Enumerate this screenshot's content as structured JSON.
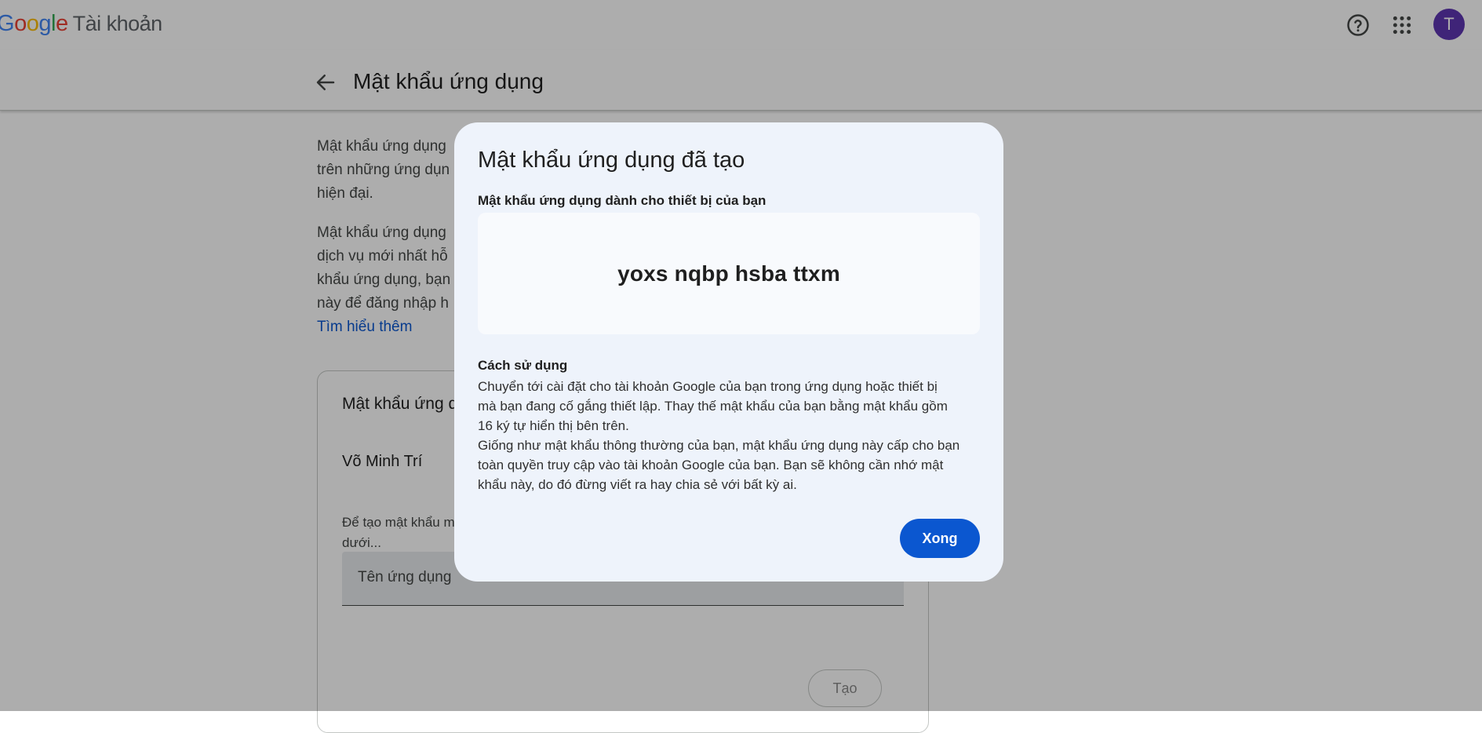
{
  "header": {
    "logo_letters": [
      "G",
      "o",
      "o",
      "g",
      "l",
      "e"
    ],
    "product_name": "Tài khoản",
    "avatar_initial": "T",
    "icons": [
      "help-icon",
      "apps-grid-icon"
    ]
  },
  "subheader": {
    "title": "Mật khẩu ứng dụng",
    "icon": "back-arrow-icon"
  },
  "background": {
    "para1_lines": [
      "Mật khẩu ứng dụng",
      "trên những ứng dụn",
      "hiện đại."
    ],
    "para2_lines": [
      "Mật khẩu ứng dụng",
      "dịch vụ mới nhất hỗ",
      "khẩu ứng dụng, bạn",
      "này để đăng nhập h"
    ],
    "learn_more": "Tìm hiểu thêm",
    "card": {
      "title": "Mật khẩu ứng d",
      "name": "Võ Minh Trí",
      "hint": "Để tạo mật khẩu m",
      "hint2": "dưới...",
      "input_placeholder": "Tên ứng dụng",
      "create_label": "Tạo"
    }
  },
  "dialog": {
    "title": "Mật khẩu ứng dụng đã tạo",
    "subtitle": "Mật khẩu ứng dụng dành cho thiết bị của bạn",
    "password": "yoxs nqbp hsba ttxm",
    "usage_title": "Cách sử dụng",
    "usage_lines": [
      "Chuyển tới cài đặt cho tài khoản Google của bạn trong ứng dụng hoặc thiết bị",
      "mà bạn đang cố gắng thiết lập. Thay thế mật khẩu của bạn bằng mật khẩu gồm",
      "16 ký tự hiển thị bên trên.",
      "Giống như mật khẩu thông thường của bạn, mật khẩu ứng dụng này cấp cho bạn",
      "toàn quyền truy cập vào tài khoản Google của bạn. Bạn sẽ không cần nhớ mật",
      "khẩu này, do đó đừng viết ra hay chia sẻ với bất kỳ ai."
    ],
    "done_label": "Xong"
  },
  "colors": {
    "accent": "#0b57d0",
    "avatar": "#5e35b1",
    "dialog_bg": "#eef3fb"
  }
}
